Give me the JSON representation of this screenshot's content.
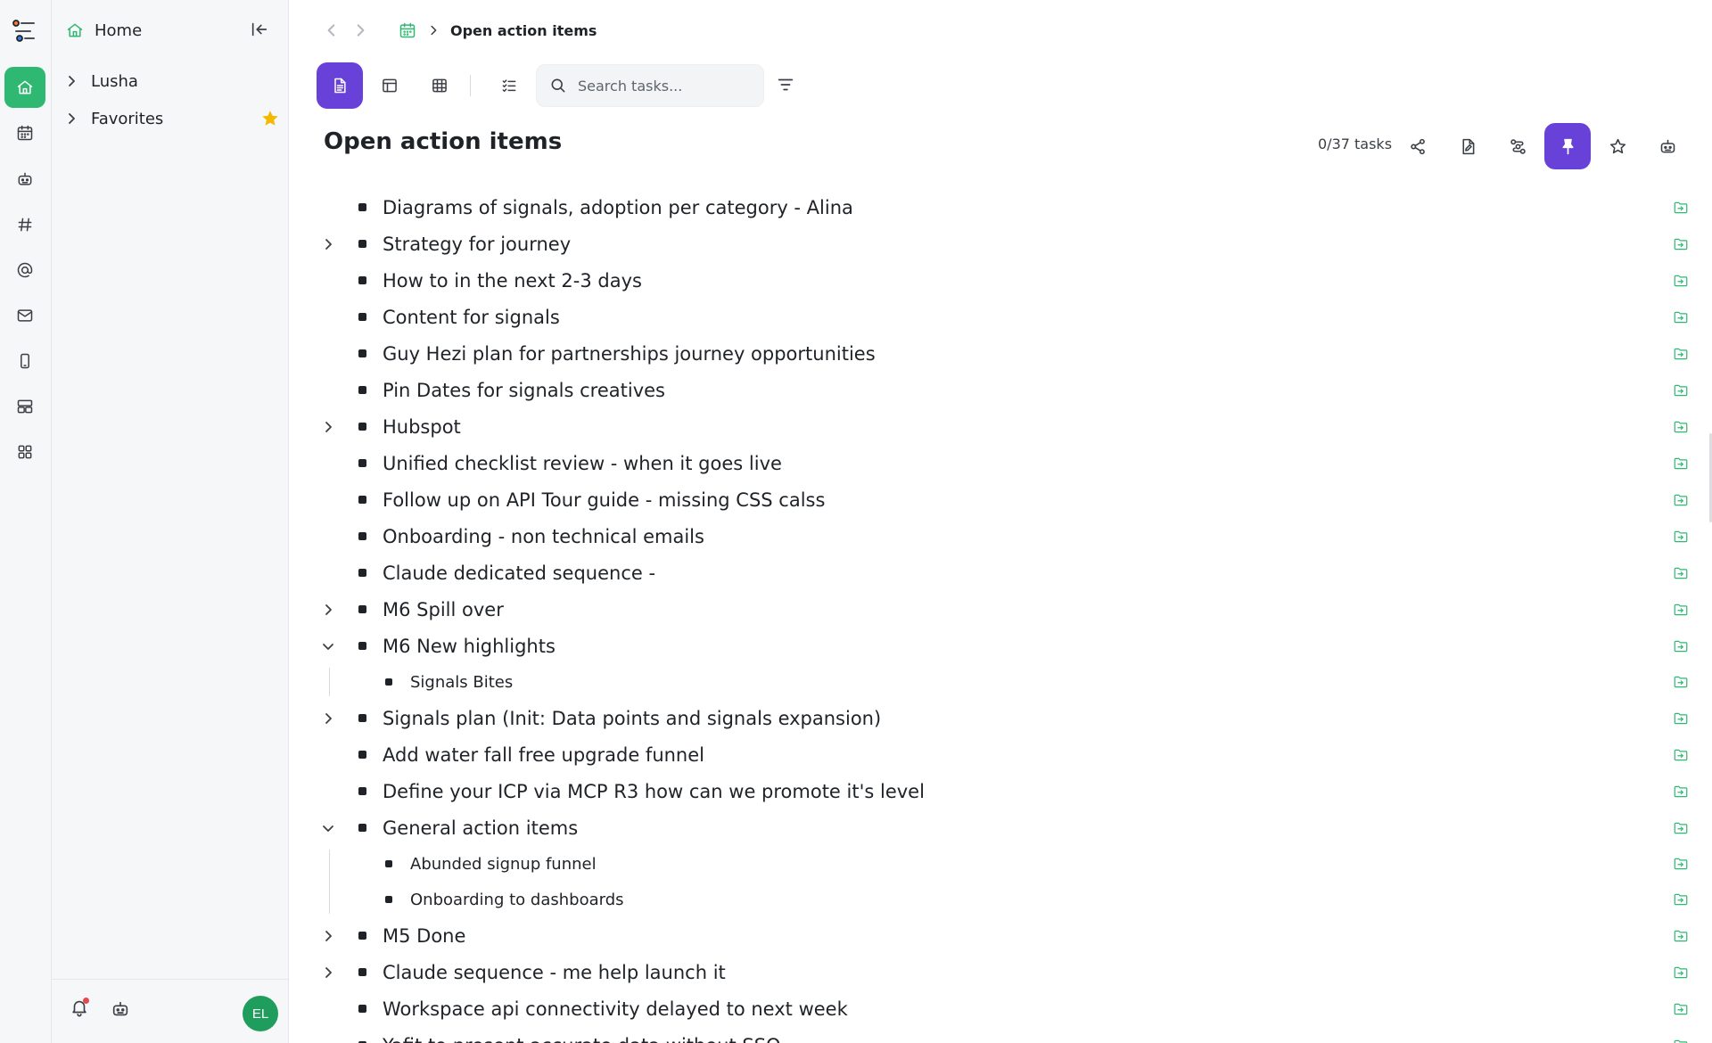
{
  "sidebar": {
    "home_label": "Home",
    "items": [
      {
        "label": "Lusha"
      },
      {
        "label": "Favorites"
      }
    ],
    "user_initials": "EL"
  },
  "breadcrumb": {
    "title": "Open action items"
  },
  "toolbar": {
    "search_placeholder": "Search tasks..."
  },
  "page": {
    "title": "Open action items",
    "task_count": "0/37 tasks"
  },
  "colors": {
    "accent_purple": "#6842d8",
    "accent_green": "#2eb872",
    "favorite_star": "#f5b800"
  },
  "tasks": [
    {
      "text": "Diagrams of signals, adoption per category - Alina",
      "level": 0,
      "toggle": "none"
    },
    {
      "text": "Strategy for journey",
      "level": 0,
      "toggle": "collapsed"
    },
    {
      "text": "How to in the next 2-3 days",
      "level": 0,
      "toggle": "none"
    },
    {
      "text": "Content for signals",
      "level": 0,
      "toggle": "none"
    },
    {
      "text": "Guy Hezi plan for partnerships journey opportunities",
      "level": 0,
      "toggle": "none"
    },
    {
      "text": "Pin Dates for signals creatives",
      "level": 0,
      "toggle": "none"
    },
    {
      "text": "Hubspot",
      "level": 0,
      "toggle": "collapsed"
    },
    {
      "text": "Unified checklist review - when it goes live",
      "level": 0,
      "toggle": "none"
    },
    {
      "text": "Follow up on API Tour guide - missing CSS calss",
      "level": 0,
      "toggle": "none"
    },
    {
      "text": "Onboarding - non technical emails",
      "level": 0,
      "toggle": "none"
    },
    {
      "text": "Claude dedicated sequence -",
      "level": 0,
      "toggle": "none"
    },
    {
      "text": "M6 Spill over",
      "level": 0,
      "toggle": "collapsed"
    },
    {
      "text": "M6 New highlights",
      "level": 0,
      "toggle": "expanded"
    },
    {
      "text": "Signals Bites",
      "level": 1,
      "toggle": "none"
    },
    {
      "text": "Signals plan (Init: Data points and signals expansion)",
      "level": 0,
      "toggle": "collapsed"
    },
    {
      "text": "Add water fall free upgrade funnel",
      "level": 0,
      "toggle": "none"
    },
    {
      "text": "Define your ICP via MCP R3 how can we promote it's level",
      "level": 0,
      "toggle": "none"
    },
    {
      "text": "General action items",
      "level": 0,
      "toggle": "expanded"
    },
    {
      "text": "Abunded signup funnel",
      "level": 1,
      "toggle": "none"
    },
    {
      "text": "Onboarding to dashboards",
      "level": 1,
      "toggle": "none"
    },
    {
      "text": "M5 Done",
      "level": 0,
      "toggle": "collapsed"
    },
    {
      "text": "Claude sequence - me help launch it",
      "level": 0,
      "toggle": "collapsed"
    },
    {
      "text": "Workspace api connectivity delayed to next week",
      "level": 0,
      "toggle": "none"
    },
    {
      "text": "Yafit to present accurate data without SSO",
      "level": 0,
      "toggle": "none"
    }
  ]
}
